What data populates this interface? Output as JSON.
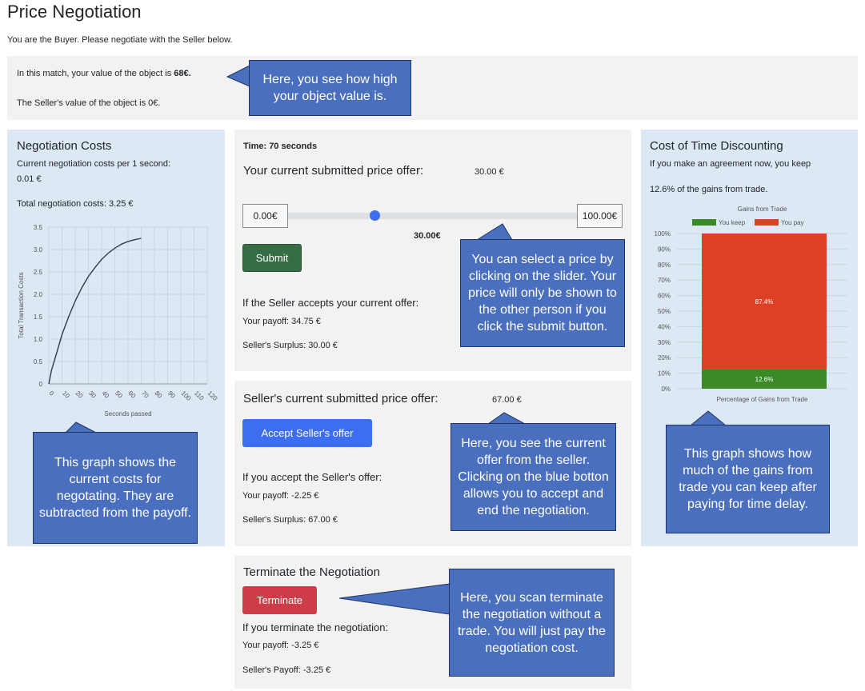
{
  "header": {
    "title": "Price Negotiation",
    "role_text": "You are the Buyer. Please negotiate with the Seller below."
  },
  "value_box": {
    "line1_prefix": "In this match, your value of the object is ",
    "line1_value": "68€.",
    "line2": "The Seller's value of the object is 0€."
  },
  "costs_panel": {
    "title": "Negotiation Costs",
    "per_second_label": "Current negotiation costs per 1 second:",
    "per_second_value": "0.01 €",
    "total_label": "Total negotiation costs: 3.25 €"
  },
  "offer_panel": {
    "time": "Time: 70 seconds",
    "heading": "Your current submitted price offer:",
    "heading_value": "30.00 €",
    "slider_min": "0.00€",
    "slider_max": "100.00€",
    "slider_current": "30.00€",
    "slider_fraction": 0.3,
    "submit_label": "Submit",
    "accept_heading": "If the Seller accepts your current offer:",
    "your_payoff": "Your payoff: 34.75 €",
    "seller_surplus": "Seller's Surplus: 30.00 €"
  },
  "seller_panel": {
    "heading": "Seller's current submitted price offer:",
    "heading_value": "67.00 €",
    "accept_button": "Accept Seller's offer",
    "accept_heading": "If you accept the Seller's offer:",
    "your_payoff": "Your payoff: -2.25 €",
    "seller_surplus": "Seller's Surplus: 67.00 €"
  },
  "terminate_panel": {
    "heading": "Terminate the Negotiation",
    "button": "Terminate",
    "subheading": "If you terminate the negotiation:",
    "your_payoff": "Your payoff: -3.25 €",
    "seller_payoff": "Seller's Payoff: -3.25 €"
  },
  "discount_panel": {
    "title": "Cost of Time Discounting",
    "line1": "If you make an agreement now, you keep",
    "line2": "12.6% of the gains from trade."
  },
  "callouts": {
    "value": "Here, you see how high your object value is.",
    "costs": "This graph shows the current costs for negotating. They are subtracted from the payoff.",
    "slider": "You can select a price by clicking on the slider. Your price will only be shown to the other person if you click the submit button.",
    "seller": "Here, you see the current offer from the seller. Clicking on the blue botton allows you to accept and end the negotiation.",
    "gains": "This graph shows how much of the gains from trade you can keep after paying for time delay.",
    "terminate": "Here, you scan terminate the negotiation without a trade. You will just pay the negotiation cost."
  },
  "colors": {
    "submit": "#356e44",
    "accept": "#3e6ef0",
    "terminate": "#cc3d47",
    "keep": "#3a8b25",
    "pay": "#dc4124",
    "callout": "#4a6fbe"
  },
  "chart_data": [
    {
      "type": "line",
      "title": "",
      "xlabel": "Seconds passed",
      "ylabel": "Total Transaction Costs",
      "x_ticks": [
        0,
        10,
        20,
        30,
        40,
        50,
        60,
        70,
        80,
        90,
        100,
        110,
        120
      ],
      "y_ticks": [
        0,
        0.5,
        1.0,
        1.5,
        2.0,
        2.5,
        3.0,
        3.5
      ],
      "y_tick_labels": [
        "0",
        "0.5",
        "1.0",
        "1.5",
        "2.0",
        "2.5",
        "3.0",
        "3.5"
      ],
      "xlim": [
        0,
        120
      ],
      "ylim": [
        0,
        3.5
      ],
      "grid": true,
      "x": [
        0,
        2,
        5,
        10,
        15,
        20,
        25,
        30,
        35,
        40,
        45,
        50,
        55,
        60,
        65,
        70
      ],
      "y": [
        0,
        0.3,
        0.6,
        1.1,
        1.5,
        1.85,
        2.15,
        2.4,
        2.6,
        2.78,
        2.92,
        3.03,
        3.12,
        3.18,
        3.22,
        3.25
      ]
    },
    {
      "type": "bar",
      "title": "Gains from Trade",
      "xlabel": "Percentage of Gains from Trade",
      "legend": [
        "You keep",
        "You pay"
      ],
      "legend_position": "top",
      "y_ticks": [
        "0%",
        "10%",
        "20%",
        "30%",
        "40%",
        "50%",
        "60%",
        "70%",
        "80%",
        "90%",
        "100%"
      ],
      "ylim": [
        0,
        100
      ],
      "series": [
        {
          "name": "You keep",
          "values": [
            12.6
          ],
          "label": "12.6%"
        },
        {
          "name": "You pay",
          "values": [
            87.4
          ],
          "label": "87.4%"
        }
      ]
    }
  ]
}
